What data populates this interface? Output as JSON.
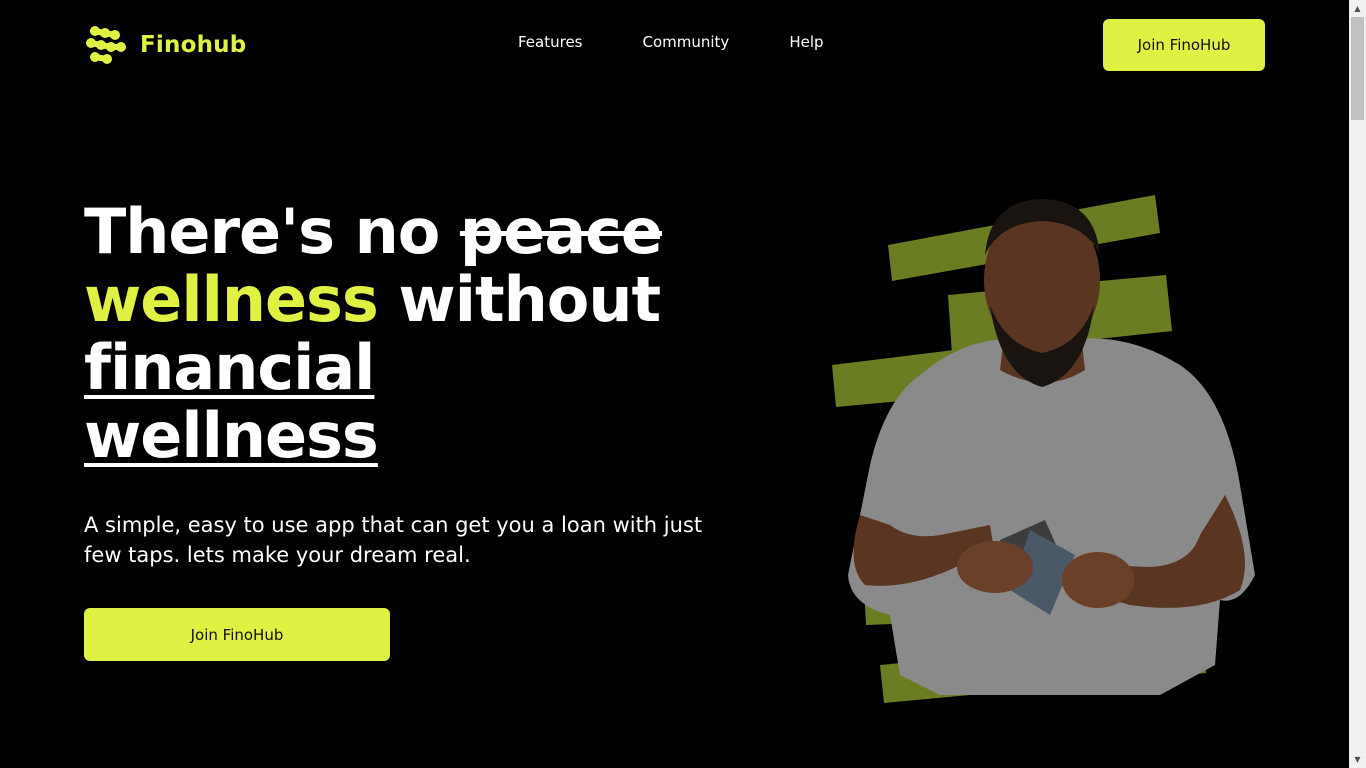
{
  "brand": {
    "name": "Finohub",
    "accent_color": "#dff244",
    "background_color": "#000000",
    "logo_icon": "finohub-logo-icon"
  },
  "nav": {
    "items": [
      {
        "label": "Features"
      },
      {
        "label": "Community"
      },
      {
        "label": "Help"
      }
    ],
    "cta_label": "Join FinoHub"
  },
  "hero": {
    "headline": {
      "part1": "There's no ",
      "struck_word": "peace",
      "accent_word": "wellness",
      "part2": " without",
      "underlined_line1": "financial",
      "underlined_line2": "wellness"
    },
    "subtext": "A simple, easy to use app that can get you a loan with just few taps. lets make your dream real.",
    "cta_label": "Join FinoHub",
    "image": {
      "subject": "man-checking-wallet-photo",
      "backdrop_color": "#6b7d22"
    }
  }
}
